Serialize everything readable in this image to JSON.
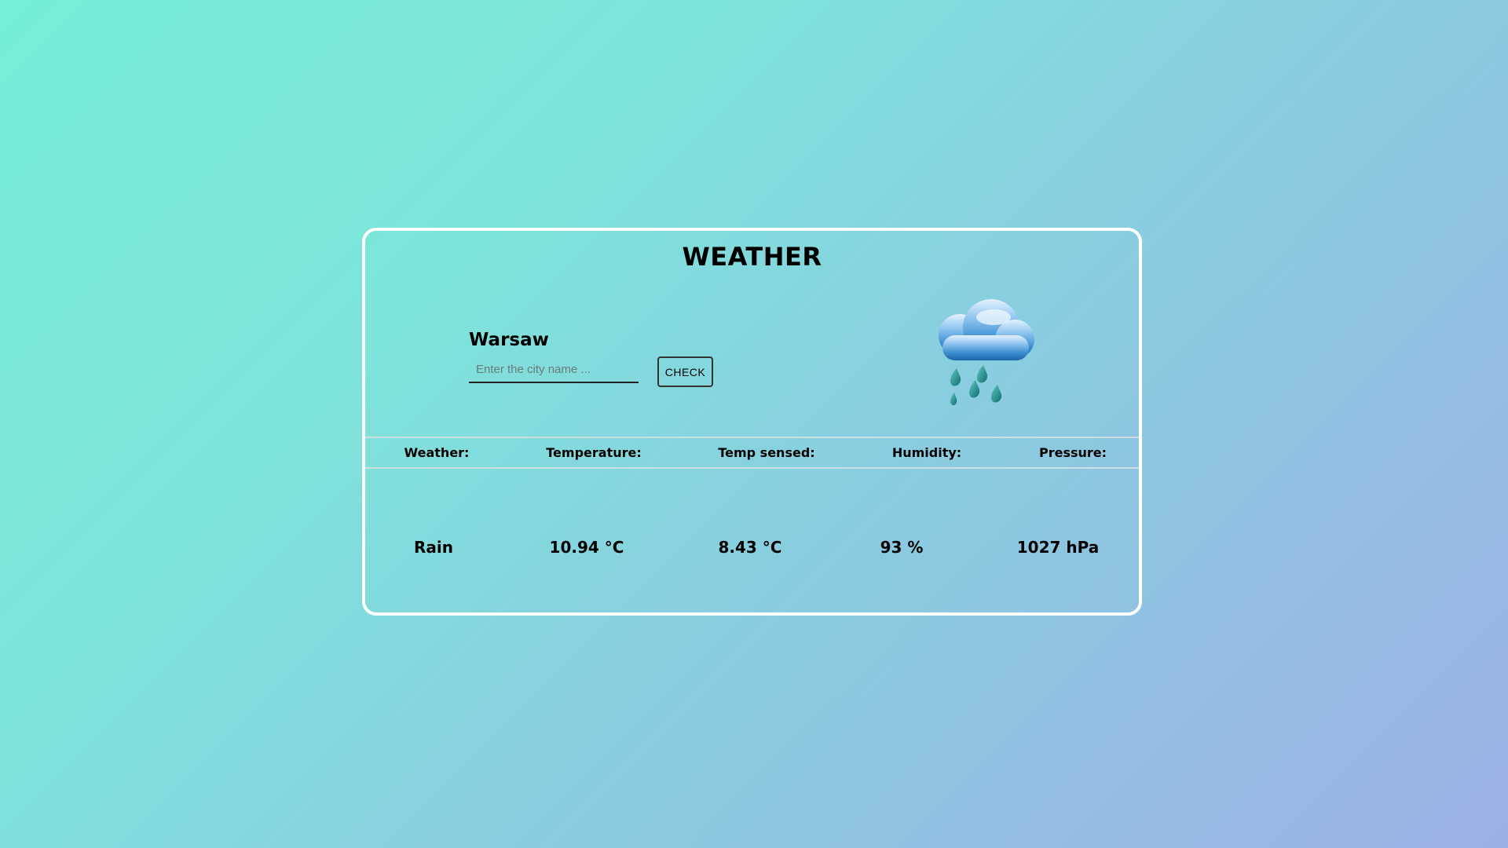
{
  "app": {
    "title": "WEATHER"
  },
  "search": {
    "current_city": "Warsaw",
    "placeholder": "Enter the city name ...",
    "value": "",
    "button_label": "CHECK"
  },
  "icon": {
    "name": "rain-cloud-icon"
  },
  "stats": {
    "labels": [
      "Weather:",
      "Temperature:",
      "Temp sensed:",
      "Humidity:",
      "Pressure:"
    ],
    "values": [
      "Rain",
      "10.94 °C",
      "8.43 °C",
      "93 %",
      "1027 hPa"
    ]
  },
  "colors": {
    "card_border": "#ffffff",
    "gradient_start": "#74eed7",
    "gradient_end": "#9db0e4"
  }
}
